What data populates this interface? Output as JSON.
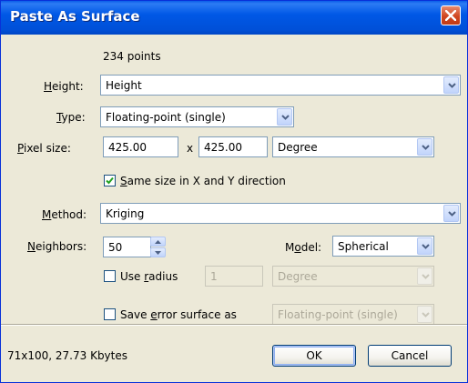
{
  "window": {
    "title": "Paste As Surface"
  },
  "info": {
    "points": "234 points"
  },
  "height": {
    "label": "Height:",
    "value": "Height"
  },
  "type": {
    "label": "Type:",
    "value": "Floating-point (single)"
  },
  "pixel_size": {
    "label": "Pixel size:",
    "x_value": "425.00",
    "sep": "x",
    "y_value": "425.00",
    "unit": "Degree"
  },
  "same_size": {
    "label": "Same size in X and Y direction",
    "checked": true
  },
  "method": {
    "label": "Method:",
    "value": "Kriging"
  },
  "neighbors": {
    "label": "Neighbors:",
    "value": "50"
  },
  "model": {
    "label": "Model:",
    "value": "Spherical"
  },
  "use_radius": {
    "label": "Use radius",
    "checked": false,
    "value": "1",
    "unit": "Degree"
  },
  "save_error": {
    "label": "Save error surface as",
    "checked": false,
    "value": "Floating-point (single)"
  },
  "status": {
    "text": "71x100, 27.73 Kbytes"
  },
  "buttons": {
    "ok": "OK",
    "cancel": "Cancel"
  },
  "icons": [
    "close-icon",
    "chevron-down-icon",
    "checkmark-icon",
    "spin-up-icon",
    "spin-down-icon"
  ],
  "colors": {
    "titlebar": "#0058e6",
    "close_button": "#d0461f",
    "dialog_bg": "#ece9d8",
    "field_border": "#7f9db9"
  }
}
